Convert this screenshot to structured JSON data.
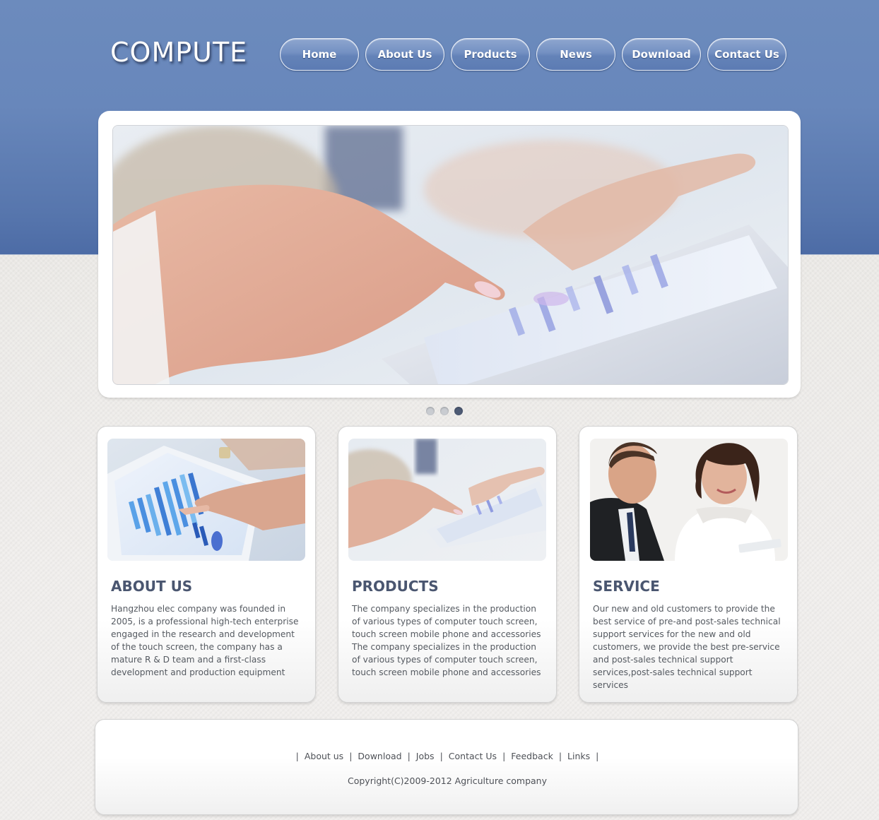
{
  "brand": {
    "logo_text": "COMPUTE"
  },
  "nav": {
    "items": [
      {
        "label": "Home"
      },
      {
        "label": "About Us"
      },
      {
        "label": "Products"
      },
      {
        "label": "News"
      },
      {
        "label": "Download"
      },
      {
        "label": "Contact Us"
      }
    ]
  },
  "slider": {
    "slide_count": 3,
    "active_slide": 3
  },
  "cards": [
    {
      "title": "ABOUT US",
      "text": "Hangzhou elec company was founded in 2005, is a professional high-tech enterprise engaged in the research and development of the touch screen, the company has a mature R & D team and a first-class development and production equipment"
    },
    {
      "title": "PRODUCTS",
      "text": "The company specializes in the production of various types of computer touch screen, touch screen mobile phone and accessories The company specializes in the production of various types of computer touch screen, touch screen mobile phone and accessories"
    },
    {
      "title": "SERVICE",
      "text": "Our new and old customers to provide the best service of pre-and post-sales technical support services for the new and old customers, we provide the best pre-service and post-sales technical support services,post-sales technical support services"
    }
  ],
  "footer": {
    "links": [
      {
        "label": "About us"
      },
      {
        "label": "Download"
      },
      {
        "label": "Jobs"
      },
      {
        "label": "Contact Us"
      },
      {
        "label": "Feedback"
      },
      {
        "label": "Links"
      }
    ],
    "separator": "|",
    "copyright": "Copyright(C)2009-2012 Agriculture company"
  },
  "colors": {
    "header_blue": "#6887bb",
    "heading_text": "#4a5670",
    "body_text": "#555a61",
    "active_dot": "#4d5a74"
  }
}
